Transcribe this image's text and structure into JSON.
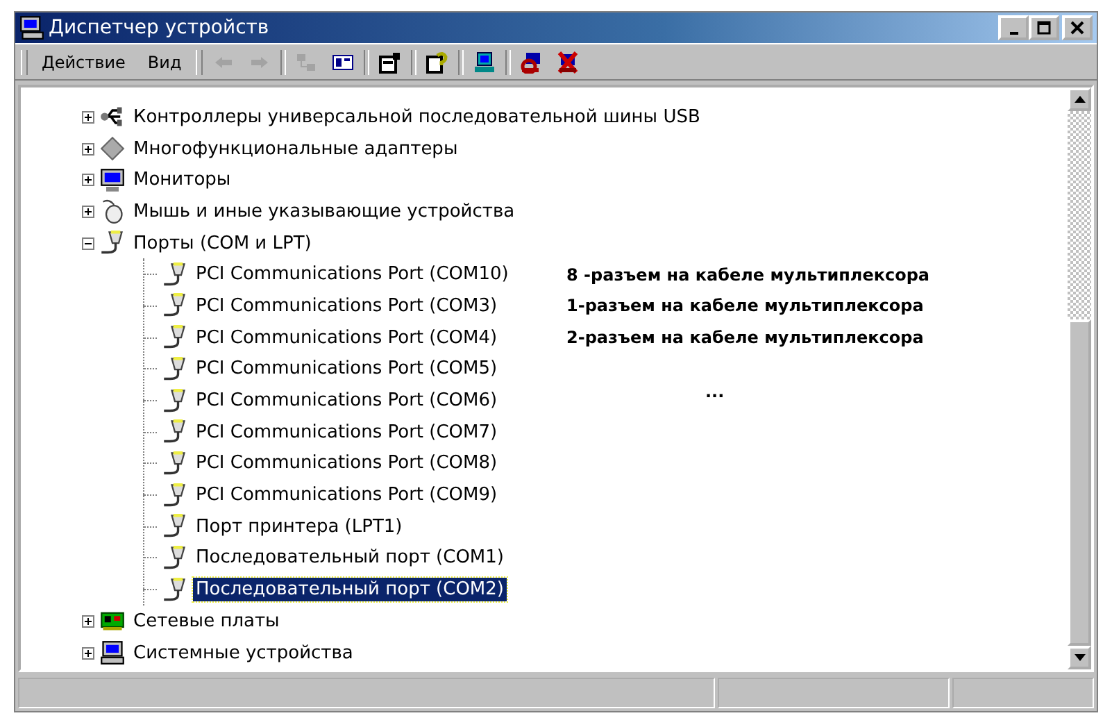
{
  "window": {
    "title": "Диспетчер устройств"
  },
  "menu": [
    {
      "label": "Действие"
    },
    {
      "label": "Вид"
    }
  ],
  "toolbar": [
    {
      "kind": "back",
      "disabled": true
    },
    {
      "kind": "forward",
      "disabled": true
    },
    {
      "kind": "sep"
    },
    {
      "kind": "tree",
      "disabled": true
    },
    {
      "kind": "list",
      "disabled": false
    },
    {
      "kind": "sep"
    },
    {
      "kind": "props",
      "disabled": false
    },
    {
      "kind": "sep"
    },
    {
      "kind": "help",
      "disabled": false
    },
    {
      "kind": "sep"
    },
    {
      "kind": "scan",
      "disabled": false
    },
    {
      "kind": "sep"
    },
    {
      "kind": "disable",
      "disabled": false
    },
    {
      "kind": "uninstall",
      "disabled": false
    }
  ],
  "tree": [
    {
      "label": "Контроллеры универсальной последовательной шины USB",
      "kind": "usb",
      "expanded": false,
      "selected": false
    },
    {
      "label": "Многофункциональные адаптеры",
      "kind": "adapter",
      "expanded": false,
      "selected": false
    },
    {
      "label": "Мониторы",
      "kind": "monitor",
      "expanded": false,
      "selected": false
    },
    {
      "label": "Мышь и иные указывающие устройства",
      "kind": "mouse",
      "expanded": false,
      "selected": false
    },
    {
      "label": "Порты (COM и LPT)",
      "kind": "port",
      "expanded": true,
      "selected": false,
      "children": [
        {
          "label": "PCI Communications Port (COM10)",
          "kind": "port",
          "selected": false,
          "note": {
            "text": "8 -разъем на кабеле мультиплексора",
            "kind": "label"
          }
        },
        {
          "label": "PCI Communications Port (COM3)",
          "kind": "port",
          "selected": false,
          "note": {
            "text": "1-разъем на кабеле мультиплексора",
            "kind": "label"
          }
        },
        {
          "label": "PCI Communications Port (COM4)",
          "kind": "port",
          "selected": false,
          "note": {
            "text": "2-разъем на кабеле мультиплексора",
            "kind": "label"
          }
        },
        {
          "label": "PCI Communications Port (COM5)",
          "kind": "port",
          "selected": false
        },
        {
          "label": "PCI Communications Port (COM6)",
          "kind": "port",
          "selected": false,
          "note": {
            "text": "...",
            "kind": "ellipsis"
          }
        },
        {
          "label": "PCI Communications Port (COM7)",
          "kind": "port",
          "selected": false
        },
        {
          "label": "PCI Communications Port (COM8)",
          "kind": "port",
          "selected": false
        },
        {
          "label": "PCI Communications Port (COM9)",
          "kind": "port",
          "selected": false
        },
        {
          "label": "Порт принтера (LPT1)",
          "kind": "port",
          "selected": false
        },
        {
          "label": "Последовательный порт (COM1)",
          "kind": "port",
          "selected": false
        },
        {
          "label": "Последовательный порт (COM2)",
          "kind": "port",
          "selected": true
        }
      ]
    },
    {
      "label": "Сетевые платы",
      "kind": "network",
      "expanded": false,
      "selected": false
    },
    {
      "label": "Системные устройства",
      "kind": "system",
      "expanded": false,
      "selected": false
    }
  ]
}
